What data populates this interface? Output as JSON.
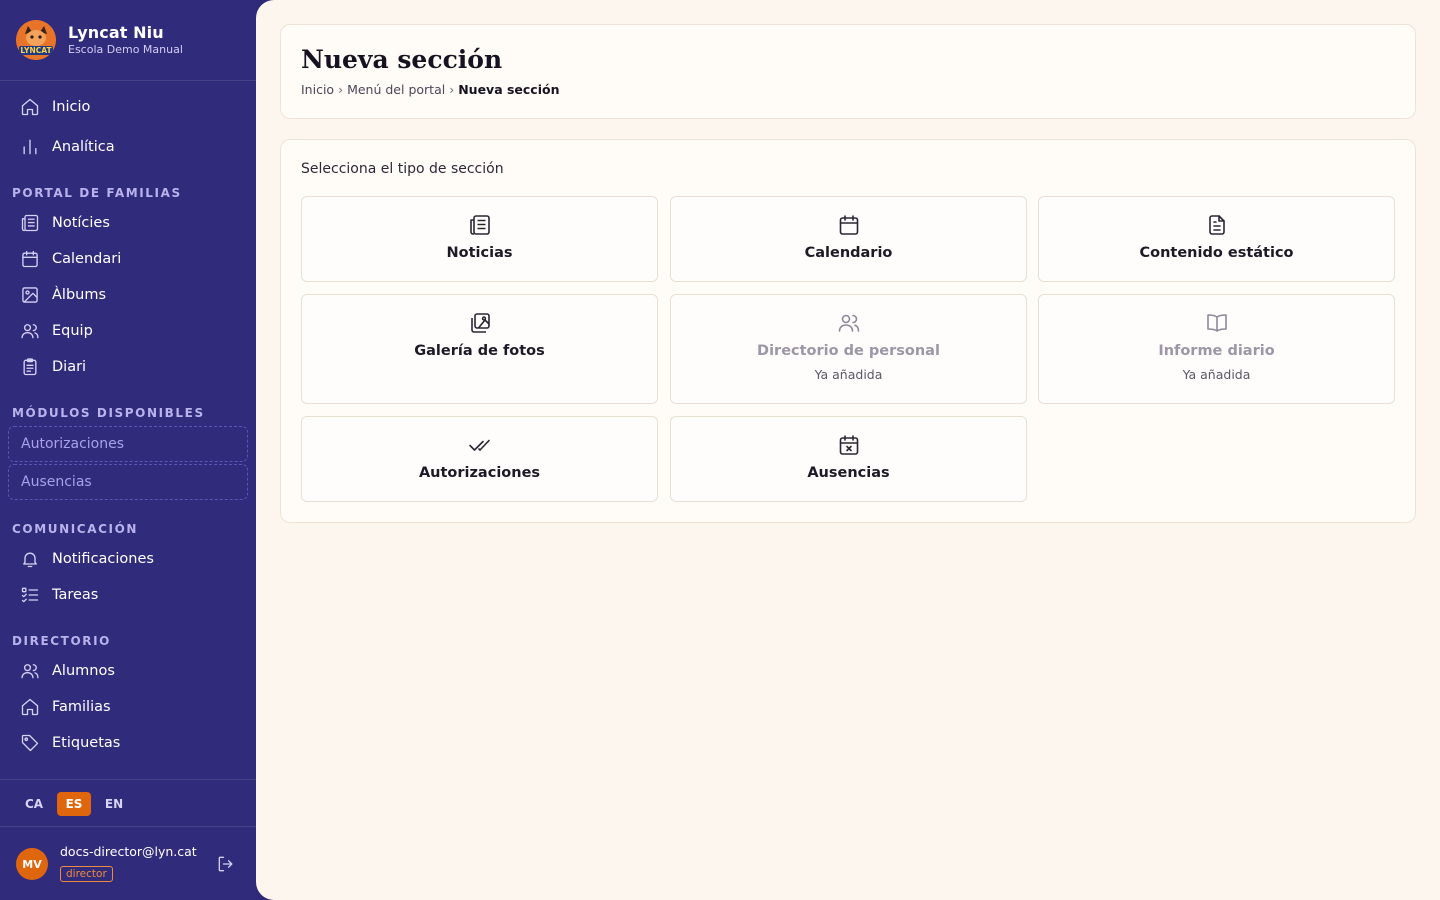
{
  "brand": {
    "name": "Lyncat Niu",
    "school": "Escola Demo Manual",
    "logo_text": "LYNCAT"
  },
  "nav_top": [
    {
      "label": "Inicio",
      "icon": "home-icon"
    },
    {
      "label": "Analítica",
      "icon": "bar-chart-icon"
    }
  ],
  "sections": {
    "portal": "PORTAL DE FAMILIAS",
    "modules": "MÓDULOS DISPONIBLES",
    "communication": "COMUNICACIÓN",
    "directory": "DIRECTORIO"
  },
  "portal_items": [
    {
      "label": "Notícies",
      "icon": "newspaper-icon"
    },
    {
      "label": "Calendari",
      "icon": "calendar-icon"
    },
    {
      "label": "Àlbums",
      "icon": "image-icon"
    },
    {
      "label": "Equip",
      "icon": "users-icon"
    },
    {
      "label": "Diari",
      "icon": "clipboard-icon"
    }
  ],
  "module_items": [
    {
      "label": "Autorizaciones"
    },
    {
      "label": "Ausencias"
    }
  ],
  "communication_items": [
    {
      "label": "Notificaciones",
      "icon": "bell-icon"
    },
    {
      "label": "Tareas",
      "icon": "checklist-icon"
    }
  ],
  "directory_items": [
    {
      "label": "Alumnos",
      "icon": "users-icon"
    },
    {
      "label": "Familias",
      "icon": "home-icon"
    },
    {
      "label": "Etiquetas",
      "icon": "tag-icon"
    }
  ],
  "languages": [
    {
      "code": "CA",
      "active": false
    },
    {
      "code": "ES",
      "active": true
    },
    {
      "code": "EN",
      "active": false
    }
  ],
  "user": {
    "initials": "MV",
    "email": "docs-director@lyn.cat",
    "role": "director"
  },
  "header": {
    "title": "Nueva sección",
    "breadcrumb": [
      "Inicio",
      "Menú del portal",
      "Nueva sección"
    ]
  },
  "picker": {
    "label": "Selecciona el tipo de sección",
    "tiles": [
      {
        "label": "Noticias",
        "icon": "newspaper-icon",
        "disabled": false,
        "note": ""
      },
      {
        "label": "Calendario",
        "icon": "calendar-icon",
        "disabled": false,
        "note": ""
      },
      {
        "label": "Contenido estático",
        "icon": "document-icon",
        "disabled": false,
        "note": ""
      },
      {
        "label": "Galería de fotos",
        "icon": "photos-icon",
        "disabled": false,
        "note": ""
      },
      {
        "label": "Directorio de personal",
        "icon": "users-icon",
        "disabled": true,
        "note": "Ya añadida"
      },
      {
        "label": "Informe diario",
        "icon": "book-open-icon",
        "disabled": true,
        "note": "Ya añadida"
      },
      {
        "label": "Autorizaciones",
        "icon": "double-check-icon",
        "disabled": false,
        "note": ""
      },
      {
        "label": "Ausencias",
        "icon": "calendar-x-icon",
        "disabled": false,
        "note": ""
      }
    ]
  },
  "colors": {
    "sidebar": "#312b7c",
    "accent": "#e0660e",
    "main_bg": "#fdf6ee"
  }
}
